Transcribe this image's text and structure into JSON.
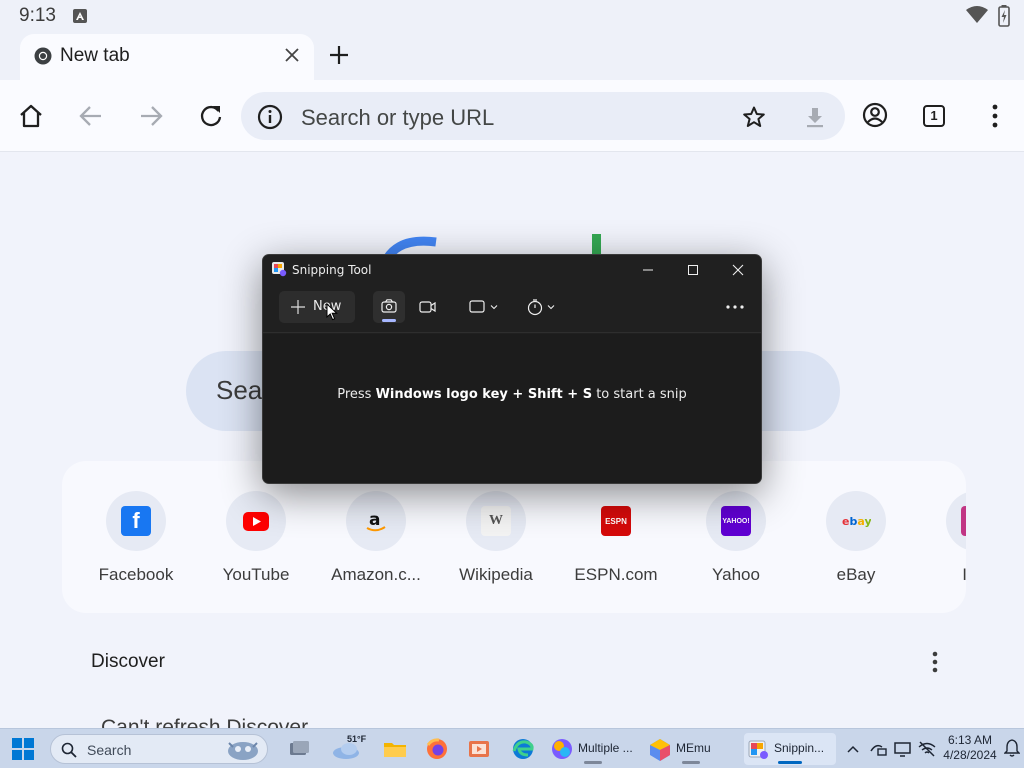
{
  "status_bar": {
    "time": "9:13"
  },
  "tab": {
    "title": "New tab"
  },
  "omnibox": {
    "placeholder": "Search or type URL",
    "tab_count": "1"
  },
  "ntp": {
    "search_partial": "Sea",
    "shortcuts": [
      {
        "label": "Facebook",
        "icon": "facebook-icon",
        "color": "#1877f2"
      },
      {
        "label": "YouTube",
        "icon": "youtube-icon",
        "color": "#ff0000"
      },
      {
        "label": "Amazon.c...",
        "icon": "amazon-icon",
        "color": "#ff9900"
      },
      {
        "label": "Wikipedia",
        "icon": "wikipedia-icon",
        "color": "#555555"
      },
      {
        "label": "ESPN.com",
        "icon": "espn-icon",
        "color": "#d50a0a"
      },
      {
        "label": "Yahoo",
        "icon": "yahoo-icon",
        "color": "#6001d2"
      },
      {
        "label": "eBay",
        "icon": "ebay-icon",
        "color": "#e53238"
      },
      {
        "label": "Inst",
        "icon": "instagram-icon",
        "color": "#c13584"
      }
    ],
    "discover_title": "Discover",
    "discover_message": "Can't refresh Discover"
  },
  "snipping_tool": {
    "title": "Snipping Tool",
    "new_label": "New",
    "hint_prefix": "Press ",
    "hint_keys": "Windows logo key + Shift + S",
    "hint_suffix": " to start a snip",
    "accent": "#a7b7ff"
  },
  "taskbar": {
    "search_placeholder": "Search",
    "weather_temp": "51°F",
    "apps": [
      {
        "label": "Multiple ...",
        "icon": "multiple-instance-icon"
      },
      {
        "label": "MEmu",
        "icon": "memu-icon"
      },
      {
        "label": "Snippin...",
        "icon": "snipping-tool-icon"
      }
    ],
    "clock_time": "6:13 AM",
    "clock_date": "4/28/2024"
  }
}
